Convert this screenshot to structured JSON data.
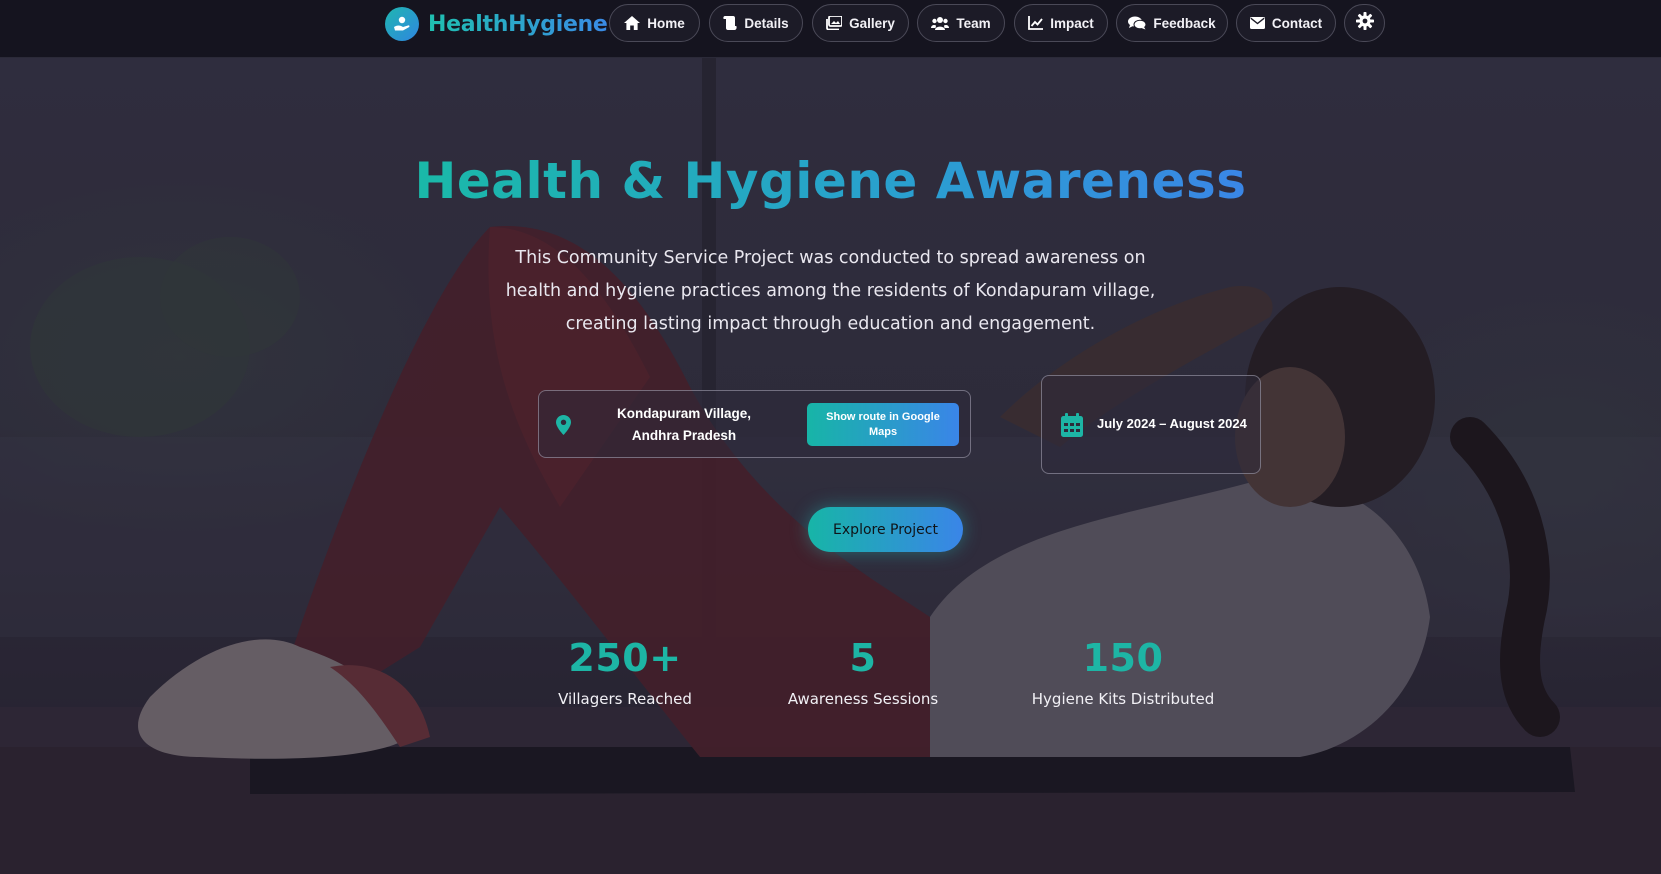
{
  "navbar": {
    "brand": "HealthHygiene",
    "items": [
      {
        "label": "Home",
        "icon": "home-icon"
      },
      {
        "label": "Details",
        "icon": "scroll-icon"
      },
      {
        "label": "Gallery",
        "icon": "images-icon"
      },
      {
        "label": "Team",
        "icon": "users-icon"
      },
      {
        "label": "Impact",
        "icon": "chart-line-icon"
      },
      {
        "label": "Feedback",
        "icon": "comments-icon"
      },
      {
        "label": "Contact",
        "icon": "envelope-icon"
      }
    ],
    "settings_icon": "gear-icon"
  },
  "hero": {
    "title": "Health & Hygiene Awareness",
    "description": "This Community Service Project was conducted to spread awareness on health and hygiene practices among the residents of Kondapuram village, creating lasting impact through education and engagement.",
    "location": {
      "text": "Kondapuram Village, Andhra Pradesh",
      "icon": "map-pin-icon",
      "button_label": "Show route in Google Maps"
    },
    "date": {
      "text": "July 2024 – August 2024",
      "icon": "calendar-icon"
    },
    "cta_label": "Explore Project",
    "stats": [
      {
        "value": "250+",
        "label": "Villagers Reached"
      },
      {
        "value": "5",
        "label": "Awareness Sessions"
      },
      {
        "value": "150",
        "label": "Hygiene Kits Distributed"
      }
    ]
  },
  "colors": {
    "accent_teal": "#1db5a5",
    "accent_blue": "#3a85e8",
    "navbar_bg": "#15141f"
  }
}
